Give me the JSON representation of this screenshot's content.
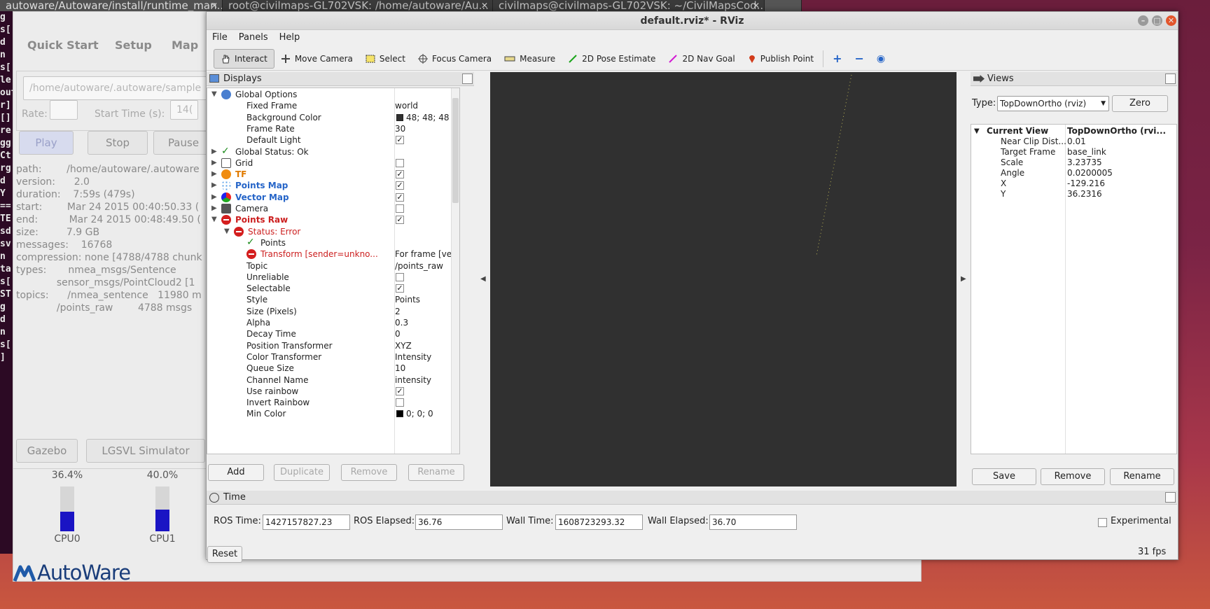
{
  "terminal": {
    "tabs": [
      "autoware/Autoware/install/runtime_man...",
      "root@civilmaps-GL702VSK: /home/autoware/Au...",
      "civilmaps@civilmaps-GL702VSK: ~/CivilMapsCod...",
      ""
    ],
    "lines": [
      "g ",
      "s[",
      "d ",
      "n ",
      "s[",
      "le",
      "",
      "",
      "out",
      "r]",
      "[]",
      "re",
      "gg",
      "Ct",
      "rg",
      "",
      "",
      "d ",
      "",
      "Y ",
      "==",
      "",
      "TE",
      "sd",
      "sv",
      "",
      "",
      "n ",
      "",
      "ta",
      "s[",
      "ST",
      "",
      "g ",
      "d ",
      "n ",
      "s[",
      "]"
    ]
  },
  "runtime_manager": {
    "tabs": [
      "Quick Start",
      "Setup",
      "Map"
    ],
    "path_field": "/home/autoware/.autoware/sample",
    "rate_label": "Rate:",
    "start_time_label": "Start Time (s):",
    "start_time_value": "14(",
    "buttons": {
      "play": "Play",
      "stop": "Stop",
      "pause": "Pause"
    },
    "info": "path:        /home/autoware/.autoware\nversion:      2.0\nduration:    7:59s (479s)\nstart:        Mar 24 2015 00:40:50.33 (\nend:          Mar 24 2015 00:48:49.50 (\nsize:         7.9 GB\nmessages:    16768\ncompression: none [4788/4788 chunk\ntypes:       nmea_msgs/Sentence\n             sensor_msgs/PointCloud2 [1\ntopics:      /nmea_sentence   11980 m\n             /points_raw        4788 msgs",
    "sim_buttons": {
      "gazebo": "Gazebo",
      "lgsvl": "LGSVL Simulator"
    },
    "cpu": [
      {
        "label": "CPU0",
        "pct_text": "36.4%",
        "pct": 36.4
      },
      {
        "label": "CPU1",
        "pct_text": "40.0%",
        "pct": 40.0
      }
    ],
    "logo": "AutoWare"
  },
  "rviz": {
    "title": "default.rviz* - RViz",
    "menu": [
      "File",
      "Panels",
      "Help"
    ],
    "tools": [
      {
        "label": "Interact",
        "icon": "hand-icon"
      },
      {
        "label": "Move Camera",
        "icon": "move-icon"
      },
      {
        "label": "Select",
        "icon": "select-icon"
      },
      {
        "label": "Focus Camera",
        "icon": "focus-icon"
      },
      {
        "label": "Measure",
        "icon": "ruler-icon"
      },
      {
        "label": "2D Pose Estimate",
        "icon": "pose-arrow-icon"
      },
      {
        "label": "2D Nav Goal",
        "icon": "goal-arrow-icon"
      },
      {
        "label": "Publish Point",
        "icon": "pin-icon"
      }
    ],
    "displays": {
      "title": "Displays",
      "rows": [
        {
          "name": "Global Options",
          "value": "",
          "indent": 0,
          "arrow": "▼",
          "icon": "globe-icon",
          "style": ""
        },
        {
          "name": "Fixed Frame",
          "value": "world",
          "indent": 1
        },
        {
          "name": "Background Color",
          "value": "48; 48; 48",
          "indent": 1,
          "swatch": "#303030"
        },
        {
          "name": "Frame Rate",
          "value": "30",
          "indent": 1
        },
        {
          "name": "Default Light",
          "value": "",
          "indent": 1,
          "check": true
        },
        {
          "name": "Global Status: Ok",
          "value": "",
          "indent": 0,
          "arrow": "▶",
          "icon": "ok-check-icon"
        },
        {
          "name": "Grid",
          "value": "",
          "indent": 0,
          "arrow": "▶",
          "icon": "grid-icon",
          "check": false
        },
        {
          "name": "TF",
          "value": "",
          "indent": 0,
          "arrow": "▶",
          "icon": "warning-icon",
          "check": true,
          "style": "orange"
        },
        {
          "name": "Points Map",
          "value": "",
          "indent": 0,
          "arrow": "▶",
          "icon": "points-map-icon",
          "check": true,
          "style": "blue"
        },
        {
          "name": "Vector Map",
          "value": "",
          "indent": 0,
          "arrow": "▶",
          "icon": "vector-map-icon",
          "check": true,
          "style": "blue"
        },
        {
          "name": "Camera",
          "value": "",
          "indent": 0,
          "arrow": "▶",
          "icon": "camera-icon",
          "check": false
        },
        {
          "name": "Points Raw",
          "value": "",
          "indent": 0,
          "arrow": "▼",
          "icon": "error-icon",
          "check": true,
          "style": "redb"
        },
        {
          "name": "Status: Error",
          "value": "",
          "indent": 1,
          "arrow": "▼",
          "icon": "error-icon",
          "style": "red"
        },
        {
          "name": "Points",
          "value": "",
          "indent": 2,
          "icon": "ok-check-icon"
        },
        {
          "name": "Transform [sender=unkno...",
          "value": "For frame [velo...",
          "indent": 2,
          "icon": "error-icon",
          "style": "red"
        },
        {
          "name": "Topic",
          "value": "/points_raw",
          "indent": 1
        },
        {
          "name": "Unreliable",
          "value": "",
          "indent": 1,
          "check": false
        },
        {
          "name": "Selectable",
          "value": "",
          "indent": 1,
          "check": true
        },
        {
          "name": "Style",
          "value": "Points",
          "indent": 1
        },
        {
          "name": "Size (Pixels)",
          "value": "2",
          "indent": 1
        },
        {
          "name": "Alpha",
          "value": "0.3",
          "indent": 1
        },
        {
          "name": "Decay Time",
          "value": "0",
          "indent": 1
        },
        {
          "name": "Position Transformer",
          "value": "XYZ",
          "indent": 1
        },
        {
          "name": "Color Transformer",
          "value": "Intensity",
          "indent": 1
        },
        {
          "name": "Queue Size",
          "value": "10",
          "indent": 1
        },
        {
          "name": "Channel Name",
          "value": "intensity",
          "indent": 1
        },
        {
          "name": "Use rainbow",
          "value": "",
          "indent": 1,
          "check": true
        },
        {
          "name": "Invert Rainbow",
          "value": "",
          "indent": 1,
          "check": false
        },
        {
          "name": "Min Color",
          "value": "0; 0; 0",
          "indent": 1,
          "swatch": "#000000"
        }
      ],
      "buttons": [
        "Add",
        "Duplicate",
        "Remove",
        "Rename"
      ]
    },
    "views": {
      "title": "Views",
      "type_label": "Type:",
      "type_value": "TopDownOrtho (rviz)",
      "zero": "Zero",
      "current_view": "Current View",
      "current_view_value": "TopDownOrtho (rvi...",
      "props": [
        {
          "k": "Near Clip Dist...",
          "v": "0.01"
        },
        {
          "k": "Target Frame",
          "v": "base_link"
        },
        {
          "k": "Scale",
          "v": "3.23735"
        },
        {
          "k": "Angle",
          "v": "0.0200005"
        },
        {
          "k": "X",
          "v": "-129.216"
        },
        {
          "k": "Y",
          "v": "36.2316"
        }
      ],
      "buttons": [
        "Save",
        "Remove",
        "Rename"
      ]
    },
    "time": {
      "title": "Time",
      "ros_time_label": "ROS Time:",
      "ros_time": "1427157827.23",
      "ros_elapsed_label": "ROS Elapsed:",
      "ros_elapsed": "36.76",
      "wall_time_label": "Wall Time:",
      "wall_time": "1608723293.32",
      "wall_elapsed_label": "Wall Elapsed:",
      "wall_elapsed": "36.70",
      "experimental": "Experimental",
      "reset": "Reset",
      "fps": "31 fps"
    }
  }
}
